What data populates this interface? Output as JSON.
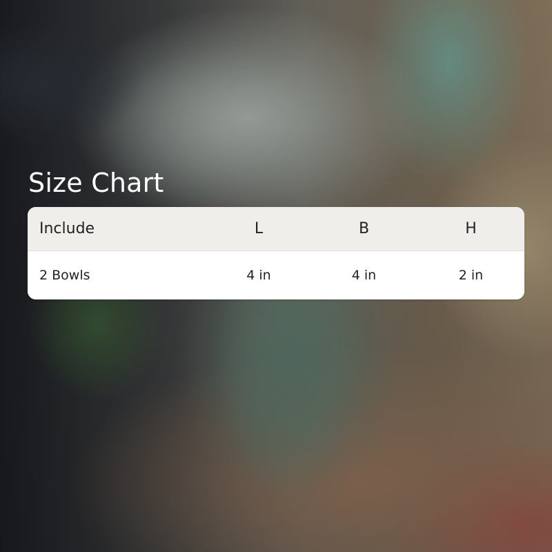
{
  "title": "Size Chart",
  "table": {
    "headers": [
      "Include",
      "L",
      "B",
      "H"
    ],
    "rows": [
      [
        "2 Bowls",
        "4 in",
        "4 in",
        "2 in"
      ]
    ]
  }
}
